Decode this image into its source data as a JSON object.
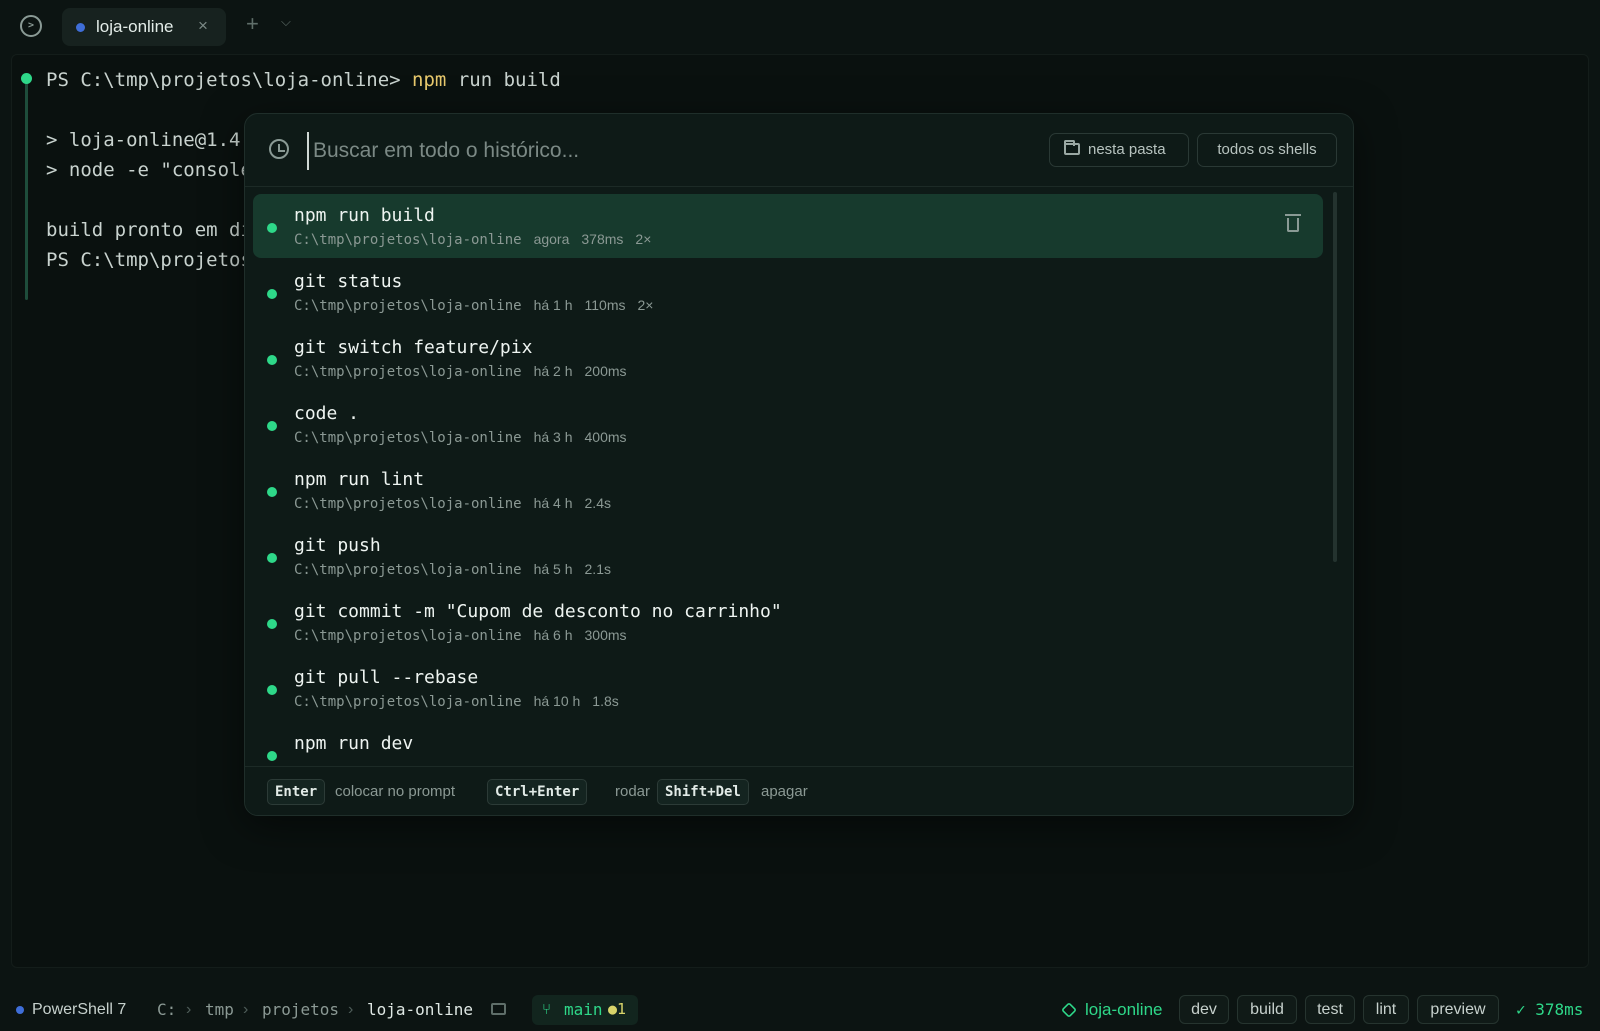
{
  "tabbar": {
    "app_icon_name": "terminal-icon",
    "tab_label": "loja-online",
    "tab_close": "×",
    "add_tab": "+",
    "chevron": "⌵"
  },
  "terminal": {
    "prompt_prefix": "PS C:\\tmp\\projetos\\loja-online> ",
    "prompt_cmd_npm": "npm",
    "prompt_cmd_rest": " run build",
    "line2": "> loja-online@1.4.",
    "line3": "> node -e \"console",
    "line4": "build pronto em di",
    "line5": "PS C:\\tmp\\projetos"
  },
  "history": {
    "search_placeholder": "Buscar em todo o histórico...",
    "search_value": "",
    "filter_folder_label": "nesta pasta",
    "filter_all_label": "todos os shells",
    "items": [
      {
        "cmd": "npm run build",
        "path": "C:\\tmp\\projetos\\loja-online",
        "when": "agora",
        "duration": "378ms",
        "count": "2×",
        "selected": true
      },
      {
        "cmd": "git status",
        "path": "C:\\tmp\\projetos\\loja-online",
        "when": "há 1 h",
        "duration": "110ms",
        "count": "2×"
      },
      {
        "cmd": "git switch feature/pix",
        "path": "C:\\tmp\\projetos\\loja-online",
        "when": "há 2 h",
        "duration": "200ms",
        "count": ""
      },
      {
        "cmd": "code .",
        "path": "C:\\tmp\\projetos\\loja-online",
        "when": "há 3 h",
        "duration": "400ms",
        "count": ""
      },
      {
        "cmd": "npm run lint",
        "path": "C:\\tmp\\projetos\\loja-online",
        "when": "há 4 h",
        "duration": "2.4s",
        "count": ""
      },
      {
        "cmd": "git push",
        "path": "C:\\tmp\\projetos\\loja-online",
        "when": "há 5 h",
        "duration": "2.1s",
        "count": ""
      },
      {
        "cmd": "git commit -m \"Cupom de desconto no carrinho\"",
        "path": "C:\\tmp\\projetos\\loja-online",
        "when": "há 6 h",
        "duration": "300ms",
        "count": ""
      },
      {
        "cmd": "git pull --rebase",
        "path": "C:\\tmp\\projetos\\loja-online",
        "when": "há 10 h",
        "duration": "1.8s",
        "count": ""
      },
      {
        "cmd": "npm run dev",
        "path": "",
        "when": "",
        "duration": "",
        "count": ""
      }
    ],
    "footer": {
      "key1": "Enter",
      "desc1": "colocar no prompt",
      "key2": "Ctrl+Enter",
      "desc2": "rodar",
      "key3": "Shift+Del",
      "desc3": "apagar"
    }
  },
  "statusbar": {
    "shell": "PowerShell 7",
    "crumbs": [
      "C:",
      "tmp",
      "projetos",
      "loja-online"
    ],
    "crumb_sep": "›",
    "branch": "main",
    "branch_changes": "●1",
    "project": "loja-online",
    "scripts": [
      "dev",
      "build",
      "test",
      "lint",
      "preview"
    ],
    "last_result": "✓ 378ms"
  },
  "colors": {
    "accent": "#2ed889",
    "selected_row": "#173a2d",
    "tab_dot": "#3f6ed8"
  }
}
